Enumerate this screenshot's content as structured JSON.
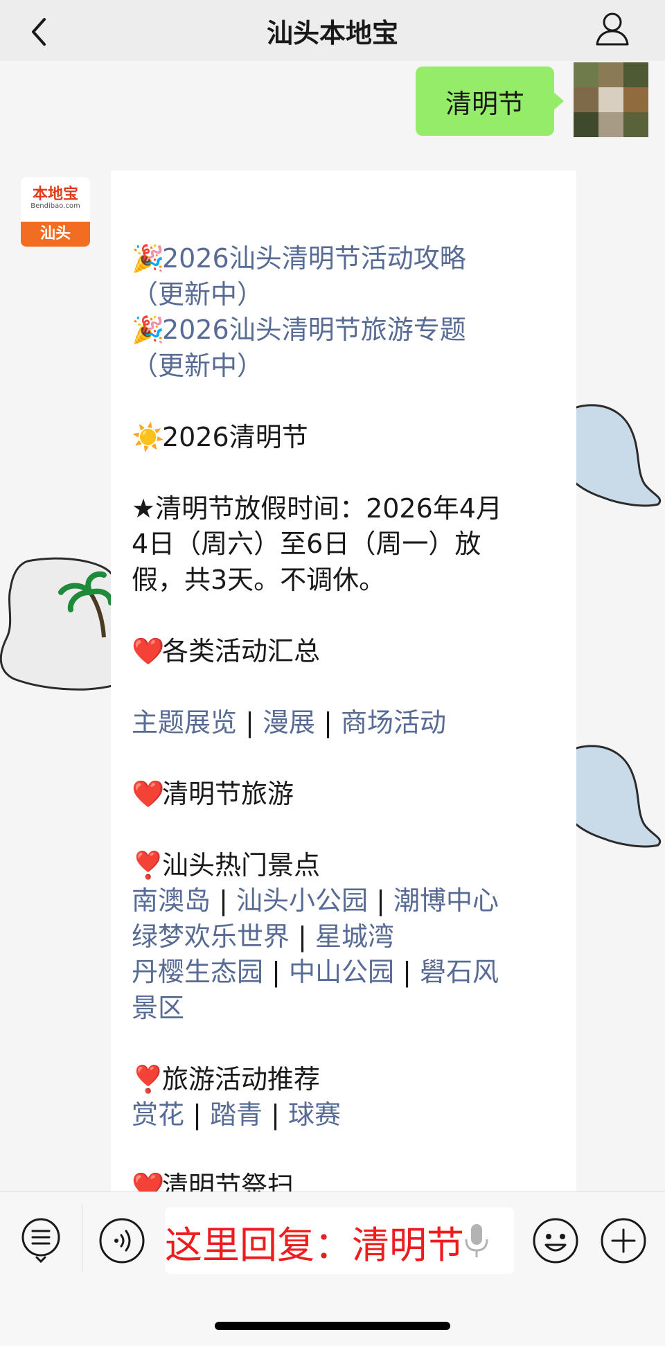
{
  "header": {
    "title": "汕头本地宝"
  },
  "sent_message": {
    "text": "清明节"
  },
  "official_account": {
    "logo_top": "本地宝",
    "logo_sub": "Bendibao.com",
    "logo_city": "汕头"
  },
  "message": {
    "headline_links": [
      {
        "emoji": "🎉",
        "text": "2026汕头清明节活动攻略",
        "sub": "（更新中）"
      },
      {
        "emoji": "🎉",
        "text": "2026汕头清明节旅游专题",
        "sub": "（更新中）"
      }
    ],
    "section_festival": {
      "emoji": "☀️",
      "text": "2026清明节"
    },
    "holiday_info": {
      "line1": "★清明节放假时间：2026年4月",
      "line2": "4日（周六）至6日（周一）放",
      "line3": "假，共3天。不调休。"
    },
    "section_activities": {
      "emoji": "❤️",
      "text": "各类活动汇总"
    },
    "activity_links": [
      "主题展览",
      "漫展",
      "商场活动"
    ],
    "section_travel": {
      "emoji": "❤️",
      "text": "清明节旅游"
    },
    "hot_spots": {
      "emoji": "❣️",
      "title": "汕头热门景点",
      "row1": [
        "南澳岛",
        "汕头小公园",
        "潮博中心"
      ],
      "row2": [
        "绿梦欢乐世界",
        "星城湾"
      ],
      "row3": [
        "丹樱生态园",
        "中山公园",
        "礐石风"
      ],
      "row3_cont": "景区"
    },
    "travel_recommend": {
      "emoji": "❣️",
      "title": "旅游活动推荐",
      "links": [
        "赏花",
        "踏青",
        "球赛"
      ]
    },
    "section_tomb": {
      "emoji": "❤️",
      "text": "清明节祭扫"
    },
    "separator": "|"
  },
  "bottom_bar": {
    "reply_text": "这里回复：清明节"
  },
  "colors": {
    "link": "#576b95",
    "sent_bubble": "#95ec69",
    "reply_text": "#ee1c1c",
    "brand_orange": "#f26d21"
  }
}
